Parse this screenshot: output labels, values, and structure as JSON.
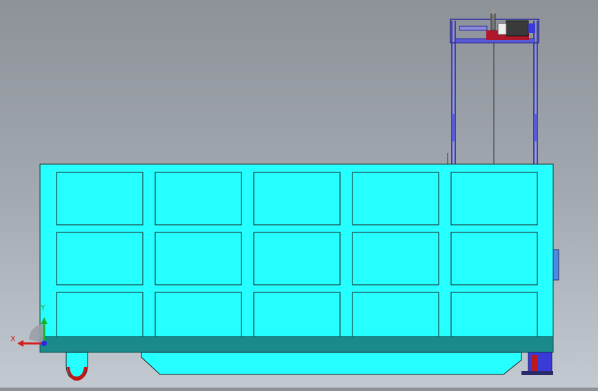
{
  "viewport": {
    "background_top": "#8d9299",
    "background_bottom": "#c3c9d0"
  },
  "model": {
    "body_color": "#25ffff",
    "base_color": "#1a8a8a",
    "frame_color": "#3a3ad6",
    "motor_color": "#b0162a",
    "grid_rows": 3,
    "grid_cols": 5
  },
  "triad": {
    "x_label": "X",
    "y_label": "Y",
    "x_color": "#d21f1f",
    "y_color": "#1fb02a",
    "z_color": "#2a2ae0"
  }
}
